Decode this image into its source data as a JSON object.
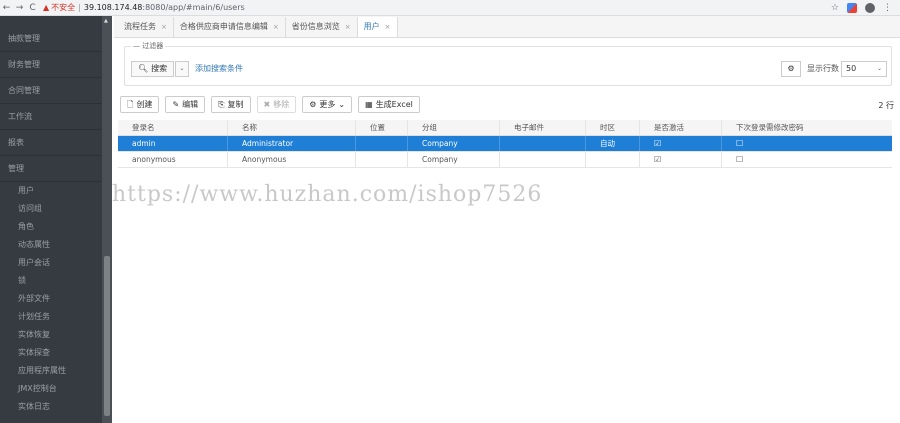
{
  "browser": {
    "back": "←",
    "forward": "→",
    "reload": "C",
    "warning_icon": "▲",
    "insecure_label": "不安全",
    "separator": "|",
    "url_host": "39.108.174.48",
    "url_rest": ":8080/app/#main/6/users",
    "star": "☆",
    "menu": "⋮"
  },
  "sidebar": {
    "items": [
      {
        "label": "抽款管理"
      },
      {
        "label": "财务管理"
      },
      {
        "label": "合同管理"
      },
      {
        "label": "工作流"
      },
      {
        "label": "报表"
      },
      {
        "label": "管理"
      }
    ],
    "sub_items": [
      {
        "label": "用户"
      },
      {
        "label": "访问组"
      },
      {
        "label": "角色"
      },
      {
        "label": "动态属性"
      },
      {
        "label": "用户会话"
      },
      {
        "label": "锁"
      },
      {
        "label": "外部文件"
      },
      {
        "label": "计划任务"
      },
      {
        "label": "实体恢复"
      },
      {
        "label": "实体探查"
      },
      {
        "label": "应用程序属性"
      },
      {
        "label": "JMX控制台"
      },
      {
        "label": "实体日志"
      }
    ]
  },
  "tabs": [
    {
      "label": "流程任务",
      "close": "×"
    },
    {
      "label": "合格供应商申请信息编辑",
      "close": "×"
    },
    {
      "label": "省份信息浏览",
      "close": "×"
    },
    {
      "label": "用户",
      "close": "×"
    }
  ],
  "filter": {
    "legend": "— 过滤器",
    "search_label": "搜索",
    "caret": "⌄",
    "add_condition": "添加搜索条件",
    "rows_label": "显示行数",
    "rows_value": "50",
    "rows_caret": "⌄"
  },
  "toolbar": {
    "create": "创建",
    "edit": "编辑",
    "copy": "复制",
    "remove": "移除",
    "more": "更多",
    "more_caret": "⌄",
    "excel": "生成Excel",
    "row_count": "2 行"
  },
  "table": {
    "headers": [
      "登录名",
      "名称",
      "位置",
      "分组",
      "电子邮件",
      "时区",
      "是否激活",
      "下次登录需修改密码"
    ],
    "rows": [
      {
        "login": "admin",
        "name": "Administrator",
        "position": "",
        "group": "Company",
        "email": "",
        "timezone": "自动",
        "active": "☑",
        "change_pw": "☐"
      },
      {
        "login": "anonymous",
        "name": "Anonymous",
        "position": "",
        "group": "Company",
        "email": "",
        "timezone": "",
        "active": "☑",
        "change_pw": "☐"
      }
    ]
  },
  "watermark": "https://www.huzhan.com/ishop7526",
  "colors": {
    "sidebar_bg": "#353b40",
    "selected_row": "#1f7fd6",
    "link": "#337ab7",
    "warning": "#d93025"
  }
}
